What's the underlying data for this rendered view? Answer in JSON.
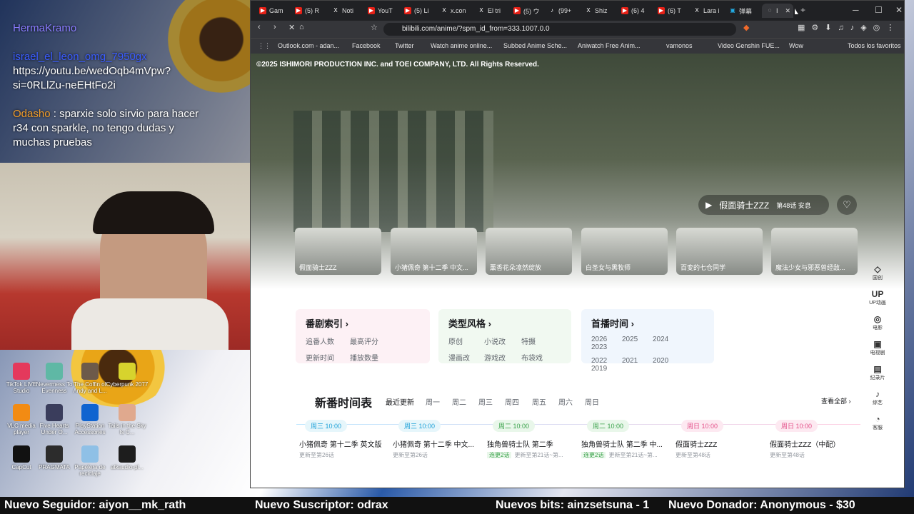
{
  "overlay": {
    "chat": [
      {
        "user": "HermaKramo",
        "msg": ""
      },
      {
        "user": "israel_el_leon_omg_7950gx",
        "msg": "https://youtu.be/wedOqb4mVpw?si=0RLlZu-neEHtFo2i"
      },
      {
        "user": "Odasho",
        "msg": "sparxie solo sirvio para hacer r34 con sparkle, no tengo dudas y muchas pruebas"
      }
    ],
    "ticker": [
      "Nuevo Seguidor: aiyon__mk_rath",
      "Nuevo Suscriptor: odrax",
      "Nuevos bits: ainzsetsuna - 1",
      "Nuevo Donador: Anonymous - $30"
    ]
  },
  "desktop": {
    "icons": [
      "TikTok LIVE Studio",
      "Nevermess To Evenness",
      "The Coffin of Andy and L...",
      "Cyberpunk 2077",
      "VLC media player",
      "Five Hearts Under O...",
      "PlayStation Accessories",
      "Tails in the Sky Is C...",
      "CapCut",
      "PRAGMATA",
      "Papelera de reciclaje",
      "atkaudio-pl..."
    ]
  },
  "browser": {
    "tabs": [
      "Gam",
      "(5) R",
      "Noti",
      "YouT",
      "(5) Li",
      "x.con",
      "El tri",
      "(5) ウ",
      "(99+",
      "Shiz",
      "(6) 4",
      "(6) T",
      "Lara i",
      "弹幕",
      "I"
    ],
    "url": "bilibili.com/anime/?spm_id_from=333.1007.0.0",
    "bookmarks": [
      "Outlook.com - adan...",
      "Facebook",
      "Twitter",
      "Watch anime online...",
      "Subbed Anime Sche...",
      "Aniwatch Free Anim...",
      "vamonos",
      "Video Genshin FUE...",
      "Wow",
      "Todos los favoritos"
    ]
  },
  "page": {
    "copyright": "©2025 ISHIMORI PRODUCTION INC. and TOEI COMPANY, LTD. All Rights Reserved.",
    "hero": {
      "title": "假面骑士ZZZ",
      "sub": "第48话 安息"
    },
    "cards": [
      "假面骑士ZZZ",
      "小猪佩奇 第十二季 中文...",
      "薰香花朵凛然绽放",
      "白圣女与黑牧师",
      "百变的七仓同学",
      "魔法少女与邪恶曾经敌..."
    ],
    "side": [
      {
        "icon": "◇",
        "label": "国创"
      },
      {
        "icon": "UP",
        "label": "UP动画"
      },
      {
        "icon": "◎",
        "label": "电影"
      },
      {
        "icon": "▣",
        "label": "电视剧"
      },
      {
        "icon": "▤",
        "label": "纪录片"
      },
      {
        "icon": "♪",
        "label": "综艺"
      },
      {
        "icon": "◔",
        "label": "客服"
      }
    ],
    "index": [
      {
        "title": "番剧索引 ›",
        "rows": [
          [
            "追番人数",
            "最高评分"
          ],
          [
            "更新时间",
            "播放数量"
          ]
        ],
        "bg": "#fdf1f5"
      },
      {
        "title": "类型风格 ›",
        "rows": [
          [
            "原创",
            "小说改",
            "特摄"
          ],
          [
            "漫画改",
            "游戏改",
            "布袋戏"
          ]
        ],
        "bg": "#f1f9f1"
      },
      {
        "title": "首播时间 ›",
        "rows": [
          [
            "2026",
            "2025",
            "2024",
            "2023"
          ],
          [
            "2022",
            "2021",
            "2020",
            "2019"
          ]
        ],
        "bg": "#f0f6fd"
      }
    ],
    "schedule": {
      "title": "新番时间表",
      "tabs": [
        "最近更新",
        "周一",
        "周二",
        "周三",
        "周四",
        "周五",
        "周六",
        "周日"
      ],
      "see_all": "查看全部 ›",
      "items": [
        {
          "day": "周三 10:00",
          "title": "小猪佩奇 第十二季 英文版",
          "sub": "更新至第26话",
          "tag": "",
          "color": "#e6f6fb",
          "fg": "#1ea1d8"
        },
        {
          "day": "周三 10:00",
          "title": "小猪佩奇 第十二季 中文...",
          "sub": "更新至第26话",
          "tag": "",
          "color": "#e6f6fb",
          "fg": "#1ea1d8"
        },
        {
          "day": "周二 10:00",
          "title": "独角兽骑士队 第二季",
          "sub": "更新至第21话~第...",
          "tag": "连更2话",
          "color": "#e9f7ea",
          "fg": "#3aa24b"
        },
        {
          "day": "周二 10:00",
          "title": "独角兽骑士队 第二季 中...",
          "sub": "更新至第21话~第...",
          "tag": "连更2话",
          "color": "#e9f7ea",
          "fg": "#3aa24b"
        },
        {
          "day": "周日 10:00",
          "title": "假面骑士ZZZ",
          "sub": "更新至第48话",
          "tag": "",
          "color": "#fde9f1",
          "fg": "#e4518a"
        },
        {
          "day": "周日 10:00",
          "title": "假面骑士ZZZ（中配）",
          "sub": "更新至第48话",
          "tag": "",
          "color": "#fde9f1",
          "fg": "#e4518a"
        }
      ]
    }
  }
}
